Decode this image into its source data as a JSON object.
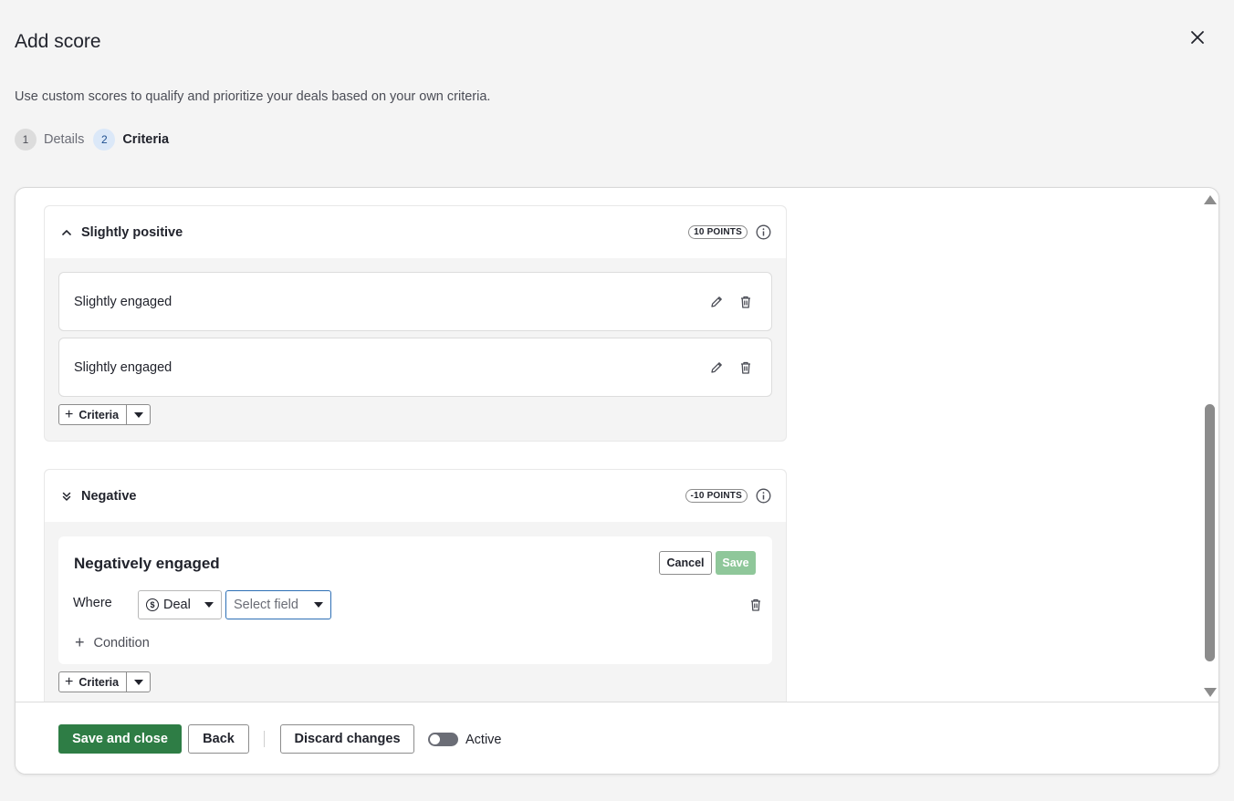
{
  "header": {
    "title": "Add score",
    "subtitle": "Use custom scores to qualify and prioritize your deals based on your own criteria."
  },
  "steps": [
    {
      "num": "1",
      "label": "Details"
    },
    {
      "num": "2",
      "label": "Criteria"
    }
  ],
  "groups": {
    "slightly_positive": {
      "title": "Slightly positive",
      "points": "10 POINTS",
      "criteria": [
        {
          "label": "Slightly engaged"
        },
        {
          "label": "Slightly engaged"
        }
      ],
      "add_label": "Criteria"
    },
    "negative": {
      "title": "Negative",
      "points": "-10 POINTS",
      "editor": {
        "title": "Negatively engaged",
        "cancel_label": "Cancel",
        "save_label": "Save",
        "where_label": "Where",
        "entity_value": "Deal",
        "field_placeholder": "Select field",
        "add_condition_label": "Condition"
      },
      "add_label": "Criteria"
    }
  },
  "footer": {
    "save_close_label": "Save and close",
    "back_label": "Back",
    "discard_label": "Discard changes",
    "active_label": "Active",
    "active_on": false
  },
  "colors": {
    "primary": "#2e7d45",
    "save_disabled": "#8fc79a",
    "focus_border": "#2d6fb5"
  }
}
